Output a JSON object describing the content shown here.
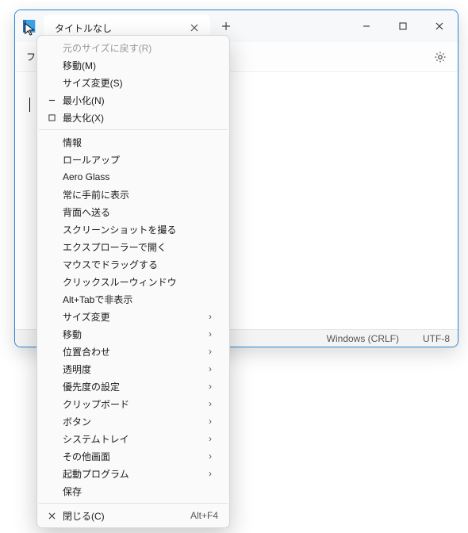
{
  "window": {
    "tab_title": "タイトルなし",
    "toolbar_first_char": "フ"
  },
  "statusbar": {
    "line_endings": "Windows (CRLF)",
    "encoding": "UTF-8"
  },
  "menu": {
    "restore": "元のサイズに戻す(R)",
    "move": "移動(M)",
    "size": "サイズ変更(S)",
    "minimize": "最小化(N)",
    "maximize": "最大化(X)",
    "info": "情報",
    "rollup": "ロールアップ",
    "aero": "Aero Glass",
    "ontop": "常に手前に表示",
    "sendback": "背面へ送る",
    "screenshot": "スクリーンショットを撮る",
    "explorer": "エクスプローラーで開く",
    "dragmouse": "マウスでドラッグする",
    "clickthrough": "クリックスルーウィンドウ",
    "alttab": "Alt+Tabで非表示",
    "resize_sub": "サイズ変更",
    "move_sub": "移動",
    "align": "位置合わせ",
    "transparency": "透明度",
    "priority": "優先度の設定",
    "clipboard": "クリップボード",
    "buttons": "ボタン",
    "systray": "システムトレイ",
    "otherscreen": "その他画面",
    "startup": "起動プログラム",
    "save": "保存",
    "close": "閉じる(C)",
    "close_accel": "Alt+F4"
  }
}
